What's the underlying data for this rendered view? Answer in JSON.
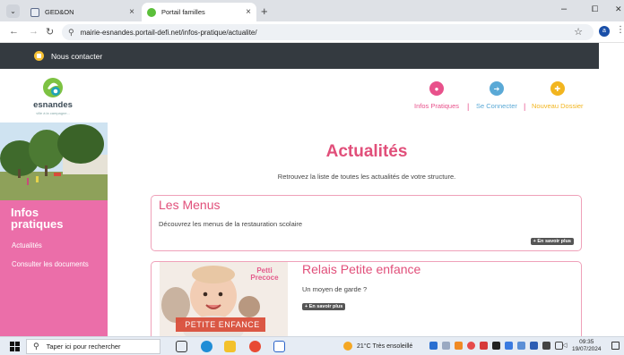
{
  "browser": {
    "tabs": [
      {
        "title": "GED&ON",
        "active": false
      },
      {
        "title": "Portail familles",
        "active": true
      }
    ],
    "url": "mairie-esnandes.portail-defi.net/infos-pratique/actualite/",
    "new_tab": "+",
    "window": {
      "minimize": "–",
      "maximize": "⧠",
      "close": "✕"
    },
    "profile_initial": "a"
  },
  "site": {
    "contact_label": "Nous contacter",
    "logo": {
      "name": "esnandes",
      "tagline": "ville à la campagne..."
    },
    "nav": [
      {
        "label": "Infos Pratiques",
        "color": "#e8518b",
        "icon": "chat-icon"
      },
      {
        "label": "Se Connecter",
        "color": "#5aa9d6",
        "icon": "login-icon"
      },
      {
        "label": "Nouveau Dossier",
        "color": "#f2b51f",
        "icon": "plus-icon"
      }
    ],
    "separator": "|",
    "sidebar": {
      "title": "Infos pratiques",
      "items": [
        "Actualités",
        "Consulter les documents"
      ]
    },
    "main": {
      "title": "Actualités",
      "subtitle": "Retrouvez la liste de toutes les actualités de votre structure.",
      "more_label": "En savoir plus",
      "cards": [
        {
          "title": "Les Menus",
          "text": "Découvrez les menus de la restauration scolaire"
        },
        {
          "title": "Relais Petite enfance",
          "text": "Un moyen de garde ?",
          "image_caption": "PETITE ENFANCE",
          "image_logo": "Petti Precoce"
        }
      ]
    }
  },
  "taskbar": {
    "search_placeholder": "Taper ici pour rechercher",
    "weather": "21°C  Très ensoleillé",
    "time": "09:35",
    "date": "19/07/2024"
  },
  "colors": {
    "accent_pink": "#e14f7a",
    "sidebar_pink": "#eb6ea9",
    "dark_bar": "#343a40"
  }
}
